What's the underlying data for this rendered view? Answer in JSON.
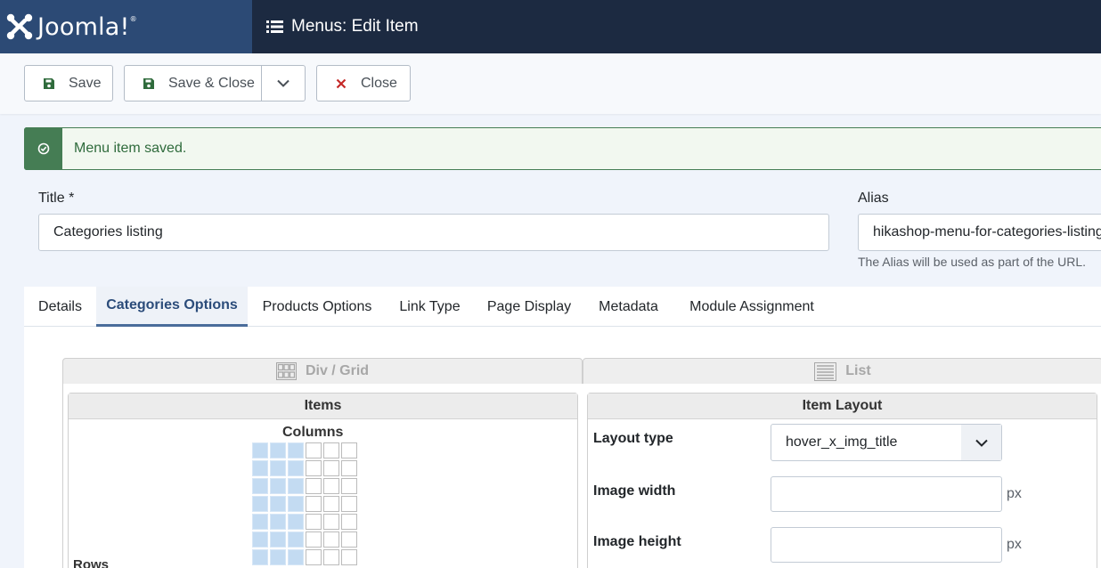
{
  "app": {
    "logo_text": "Joomla!",
    "page_title": "Menus: Edit Item"
  },
  "toolbar": {
    "save_label": "Save",
    "save_close_label": "Save & Close",
    "close_label": "Close"
  },
  "alert": {
    "message": "Menu item saved.",
    "status_color": "#457d54"
  },
  "form": {
    "title_label": "Title *",
    "title_value": "Categories listing",
    "alias_label": "Alias",
    "alias_value": "hikashop-menu-for-categories-listing",
    "alias_hint": "The Alias will be used as part of the URL."
  },
  "tabs": [
    "Details",
    "Categories Options",
    "Products Options",
    "Link Type",
    "Page Display",
    "Metadata",
    "Module Assignment"
  ],
  "active_tab": "Categories Options",
  "layout_switch": {
    "grid_label": "Div / Grid",
    "list_label": "List"
  },
  "items_panel": {
    "title": "Items",
    "columns_label": "Columns",
    "rows_label": "Rows",
    "selected_columns": 3,
    "grid_columns": 6
  },
  "item_layout_panel": {
    "title": "Item Layout",
    "layout_type_label": "Layout type",
    "layout_type_value": "hover_x_img_title",
    "image_width_label": "Image width",
    "image_width_value": "",
    "image_height_label": "Image height",
    "image_height_value": "",
    "unit": "px"
  }
}
